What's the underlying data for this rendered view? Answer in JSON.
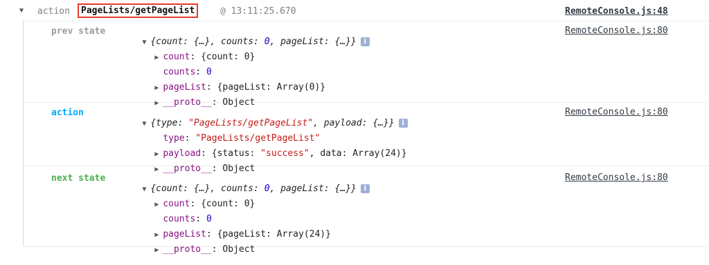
{
  "header": {
    "caret": "▼",
    "prefix": "action",
    "action_name": "PageLists/getPageList",
    "time": "@ 13:11:25.670",
    "source": "RemoteConsole.js:48"
  },
  "groups": [
    {
      "label": "prev state",
      "summary_parts": [
        "{count: {…}, counts: ",
        "0",
        ", pageList: {…}}"
      ],
      "source": "RemoteConsole.js:80",
      "lines": [
        {
          "caret": "▶",
          "key": "count",
          "value": "{count: 0}"
        },
        {
          "caret": "",
          "key": "counts",
          "value": "0"
        },
        {
          "caret": "▶",
          "key": "pageList",
          "value": "{pageList: Array(0)}"
        },
        {
          "caret": "▶",
          "key": "__proto__",
          "value": "Object"
        }
      ]
    },
    {
      "label": "action",
      "summary_parts": [
        "{type: ",
        "\"PageLists/getPageList\"",
        ", payload: {…}}"
      ],
      "source": "RemoteConsole.js:80",
      "lines": [
        {
          "caret": "",
          "key": "type",
          "value": "\"PageLists/getPageList\""
        },
        {
          "caret": "▶",
          "key": "payload",
          "value_parts": [
            "{status: ",
            "\"success\"",
            ", data: Array(24)}"
          ]
        },
        {
          "caret": "▶",
          "key": "__proto__",
          "value": "Object"
        }
      ]
    },
    {
      "label": "next state",
      "summary_parts": [
        "{count: {…}, counts: ",
        "0",
        ", pageList: {…}}"
      ],
      "source": "RemoteConsole.js:80",
      "lines": [
        {
          "caret": "▶",
          "key": "count",
          "value": "{count: 0}"
        },
        {
          "caret": "",
          "key": "counts",
          "value": "0"
        },
        {
          "caret": "▶",
          "key": "pageList",
          "value": "{pageList: Array(24)}"
        },
        {
          "caret": "▶",
          "key": "__proto__",
          "value": "Object"
        }
      ]
    }
  ],
  "info_icon_glyph": "i",
  "colors": {
    "prev_label": "#9b9b9b",
    "action_label": "#03a9f4",
    "next_label": "#4caf50",
    "highlight_border": "#e53a2b",
    "string": "#c41a16",
    "number": "#1c00cf",
    "key": "#881280"
  }
}
